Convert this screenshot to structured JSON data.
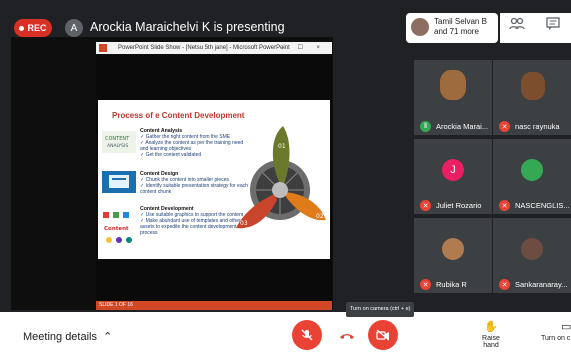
{
  "header": {
    "rec_label": "REC",
    "presenter_initial": "A",
    "presenting_text": "Arockia Maraichelvi K is presenting",
    "people_name": "Tamil Selvan B",
    "people_more": "and 71 more"
  },
  "window": {
    "title": "PowerPoint Slide Show - [Netsu 5th jane] - Microsoft PowerPoint",
    "controls": "– ☐ ×",
    "slide_status": "SLIDE 1 OF 16"
  },
  "slide": {
    "title": "Process of e Content Development",
    "sections": [
      {
        "heading": "Content Analysis",
        "bullets": [
          "Gather the right content from the SME",
          "Analyze the content as per the training need and learning objectives",
          "Get the content validated"
        ]
      },
      {
        "heading": "Content Design",
        "bullets": [
          "Chunk the content into smaller pieces",
          "Identify suitable presentation strategy for each content chunk"
        ]
      },
      {
        "heading": "Content Development",
        "bullets": [
          "Use suitable graphics to support the content",
          "Make abundant use of templates and other assets to expedite the content development process"
        ]
      }
    ],
    "blade_labels": [
      "01",
      "02",
      "03"
    ]
  },
  "participants": [
    {
      "name": "Arockia Marai...",
      "initial": "",
      "color": "#9e6b3f"
    },
    {
      "name": "nasc raynuka",
      "initial": "",
      "color": "#7d4e2d"
    },
    {
      "name": "Juliet Rozario",
      "initial": "J",
      "color": "#e91e63"
    },
    {
      "name": "NASCENGLIS...",
      "initial": "",
      "color": "#34a853"
    },
    {
      "name": "Rubika R",
      "initial": "",
      "color": "#b07b4f"
    },
    {
      "name": "Sankaranaray...",
      "initial": "",
      "color": "#6d4c41"
    }
  ],
  "footer": {
    "meeting_details": "Meeting details",
    "tooltip": "Turn on camera (ctrl + e)",
    "raise_hand": "Raise hand",
    "camera_label": "Turn on c"
  },
  "colors": {
    "rec": "#d93025",
    "danger": "#ea4335",
    "stage": "#202124",
    "slide_title": "#c0392b",
    "bullet_text": "#1f3f7a"
  }
}
